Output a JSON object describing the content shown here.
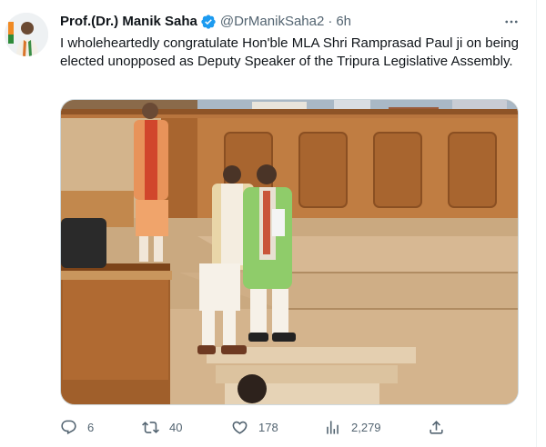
{
  "tweet": {
    "author_name": "Prof.(Dr.) Manik Saha",
    "handle": "@DrManikSaha2",
    "separator": "·",
    "time": "6h",
    "text": "I wholeheartedly congratulate Hon'ble MLA Shri Ramprasad Paul ji on being elected unopposed as Deputy Speaker of the Tripura Legislative Assembly.",
    "verified": true
  },
  "icons": {
    "verified": "verified-badge-icon",
    "more": "more-options-icon",
    "reply": "reply-icon",
    "retweet": "retweet-icon",
    "like": "like-icon",
    "views": "views-icon",
    "share": "share-icon"
  },
  "actions": {
    "replies": "6",
    "retweets": "40",
    "likes": "178",
    "views": "2,279"
  },
  "colors": {
    "verified": "#1d9bf0",
    "secondary_text": "#536471",
    "border": "#cfd9de"
  }
}
